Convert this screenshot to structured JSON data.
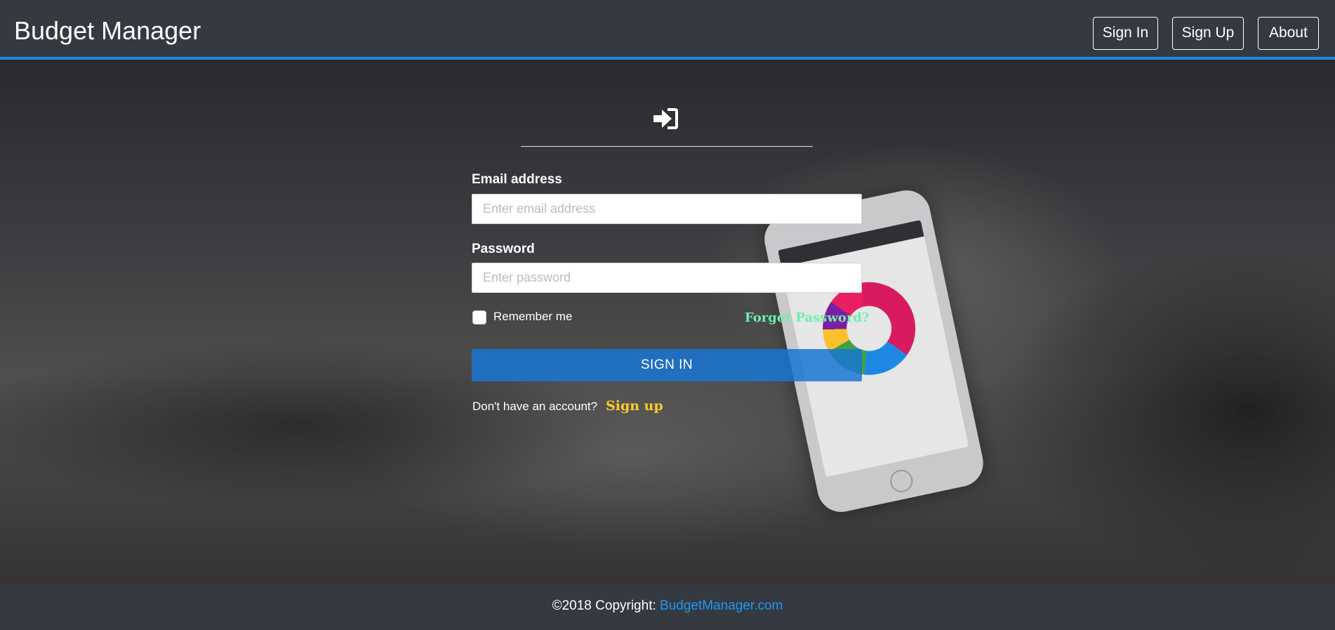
{
  "navbar": {
    "brand": "Budget Manager",
    "links": {
      "sign_in": "Sign In",
      "sign_up": "Sign Up",
      "about": "About"
    }
  },
  "form": {
    "icon": "sign-in-icon",
    "email_label": "Email address",
    "email_placeholder": "Enter email address",
    "email_value": "",
    "password_label": "Password",
    "password_placeholder": "Enter password",
    "password_value": "",
    "remember_label": "Remember me",
    "remember_checked": false,
    "forgot_password": "Forgot Password?",
    "submit_label": "SIGN IN",
    "no_account_text": "Don't have an account?",
    "signup_link": "Sign up"
  },
  "footer": {
    "copyright": "©2018 Copyright:",
    "link": "BudgetManager.com"
  },
  "colors": {
    "navbar_bg": "#343a40",
    "accent_border": "#1e88e5",
    "submit_button": "#1976d2",
    "forgot_link": "#69f0ae",
    "signup_link": "#ffca28",
    "footer_link": "#2196f3"
  }
}
